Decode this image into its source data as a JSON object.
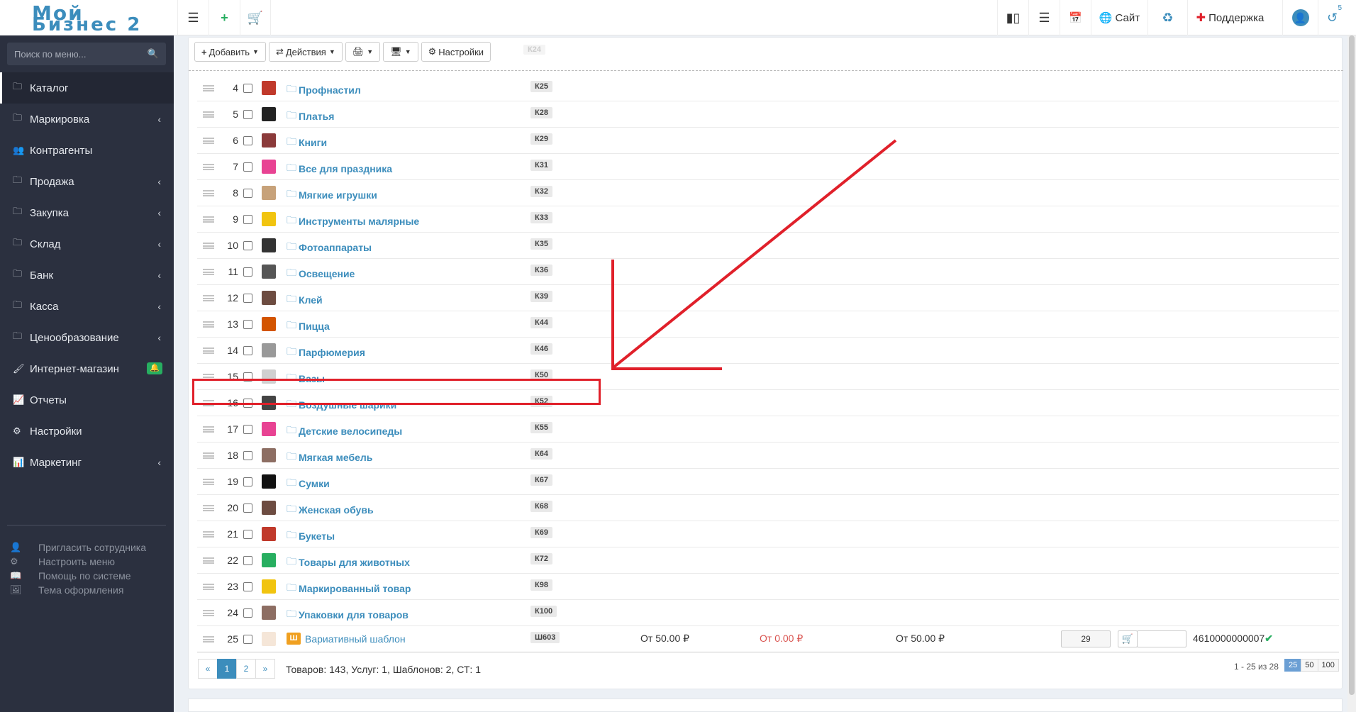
{
  "logo": {
    "line1": "Мой",
    "line2": "Бизнес 2"
  },
  "topbar": {
    "menu_icon": "hamburger-icon",
    "add_icon": "plus-icon",
    "cart_icon": "cart-icon",
    "site_label": "Сайт",
    "support_label": "Поддержка",
    "notif_count": "5"
  },
  "search": {
    "placeholder": "Поиск по меню..."
  },
  "sidebar": {
    "items": [
      {
        "label": "Каталог",
        "icon": "folder-icon",
        "chevron": false,
        "active": true
      },
      {
        "label": "Маркировка",
        "icon": "folder-icon",
        "chevron": true
      },
      {
        "label": "Контрагенты",
        "icon": "users-icon",
        "chevron": false
      },
      {
        "label": "Продажа",
        "icon": "folder-icon",
        "chevron": true
      },
      {
        "label": "Закупка",
        "icon": "folder-icon",
        "chevron": true
      },
      {
        "label": "Склад",
        "icon": "folder-icon",
        "chevron": true
      },
      {
        "label": "Банк",
        "icon": "folder-icon",
        "chevron": true
      },
      {
        "label": "Касса",
        "icon": "folder-icon",
        "chevron": true
      },
      {
        "label": "Ценообразование",
        "icon": "folder-icon",
        "chevron": true
      },
      {
        "label": "Интернет-магазин",
        "icon": "wand-icon",
        "chevron": false,
        "bell": true
      },
      {
        "label": "Отчеты",
        "icon": "chart-line-icon",
        "chevron": false
      },
      {
        "label": "Настройки",
        "icon": "gear-icon",
        "chevron": false
      },
      {
        "label": "Маркетинг",
        "icon": "chart-area-icon",
        "chevron": true
      }
    ],
    "extra": [
      {
        "label": "Пригласить сотрудника",
        "icon": "user-plus-icon"
      },
      {
        "label": "Настроить меню",
        "icon": "gears-icon"
      },
      {
        "label": "Помощь по системе",
        "icon": "book-icon"
      },
      {
        "label": "Тема оформления",
        "icon": "image-icon"
      }
    ]
  },
  "toolbar": {
    "add_label": "Добавить",
    "actions_label": "Действия",
    "print_label": "",
    "display_label": "",
    "settings_label": "Настройки",
    "faded_code": "К24"
  },
  "rows": [
    {
      "num": "4",
      "name": "Профнастил",
      "code": "К25",
      "color": "#c0392b"
    },
    {
      "num": "5",
      "name": "Платья",
      "code": "К28",
      "color": "#222222"
    },
    {
      "num": "6",
      "name": "Книги",
      "code": "К29",
      "color": "#8b3a3a"
    },
    {
      "num": "7",
      "name": "Все для праздника",
      "code": "К31",
      "color": "#e84393"
    },
    {
      "num": "8",
      "name": "Мягкие игрушки",
      "code": "К32",
      "color": "#c7a27a"
    },
    {
      "num": "9",
      "name": "Инструменты малярные",
      "code": "К33",
      "color": "#f1c40f"
    },
    {
      "num": "10",
      "name": "Фотоаппараты",
      "code": "К35",
      "color": "#333333"
    },
    {
      "num": "11",
      "name": "Освещение",
      "code": "К36",
      "color": "#555555"
    },
    {
      "num": "12",
      "name": "Клей",
      "code": "К39",
      "color": "#6d4c41"
    },
    {
      "num": "13",
      "name": "Пицца",
      "code": "К44",
      "color": "#d35400"
    },
    {
      "num": "14",
      "name": "Парфюмерия",
      "code": "К46",
      "color": "#999999"
    },
    {
      "num": "15",
      "name": "Вазы",
      "code": "К50",
      "color": "#d0d0d0"
    },
    {
      "num": "16",
      "name": "Воздушные шарики",
      "code": "К52",
      "color": "#444444"
    },
    {
      "num": "17",
      "name": "Детские велосипеды",
      "code": "К55",
      "color": "#e84393"
    },
    {
      "num": "18",
      "name": "Мягкая мебель",
      "code": "К64",
      "color": "#8d6e63"
    },
    {
      "num": "19",
      "name": "Сумки",
      "code": "К67",
      "color": "#111111"
    },
    {
      "num": "20",
      "name": "Женская обувь",
      "code": "К68",
      "color": "#6d4c41"
    },
    {
      "num": "21",
      "name": "Букеты",
      "code": "К69",
      "color": "#c0392b"
    },
    {
      "num": "22",
      "name": "Товары для животных",
      "code": "К72",
      "color": "#27ae60"
    },
    {
      "num": "23",
      "name": "Маркированный товар",
      "code": "К98",
      "color": "#f1c40f"
    },
    {
      "num": "24",
      "name": "Упаковки для товаров",
      "code": "К100",
      "color": "#8d6e63"
    }
  ],
  "template_row": {
    "num": "25",
    "badge": "Ш",
    "name": "Вариативный шаблон",
    "code": "Ш603",
    "price1": "От 50.00 ₽",
    "price2": "От 0.00 ₽",
    "price3": "От 50.00 ₽",
    "qty": "29",
    "barcode": "4610000000007",
    "check": "✔"
  },
  "pager": {
    "prev": "«",
    "p1": "1",
    "p2": "2",
    "next": "»"
  },
  "summary": "Товаров: 143, Услуг: 1, Шаблонов: 2, СТ: 1",
  "range_info": "1 - 25 из 28",
  "page_sizes": [
    "25",
    "50",
    "100"
  ],
  "colors": {
    "sidebar_bg": "#2b303f",
    "accent": "#3c8dbc",
    "highlight": "#e0202a"
  }
}
